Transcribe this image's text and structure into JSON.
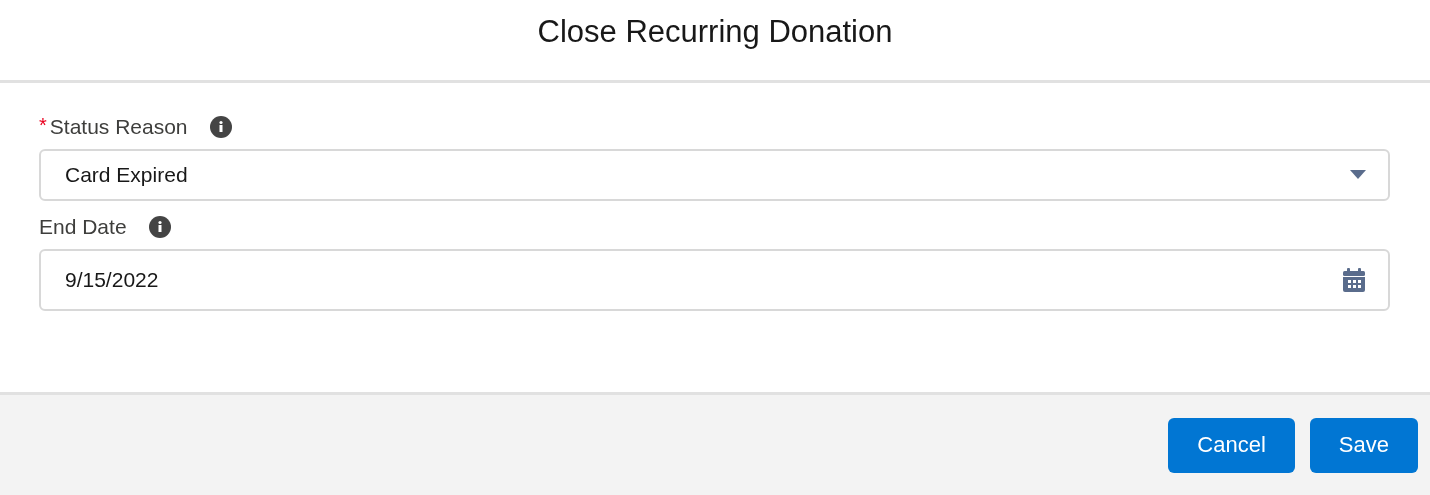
{
  "modal": {
    "title": "Close Recurring Donation"
  },
  "fields": [
    {
      "kind": "select",
      "required_mark": "*",
      "label": "Status Reason",
      "value": "Card Expired"
    },
    {
      "kind": "date",
      "label": "End Date",
      "value": "9/15/2022"
    }
  ],
  "buttons": [
    "Cancel",
    "Save"
  ]
}
